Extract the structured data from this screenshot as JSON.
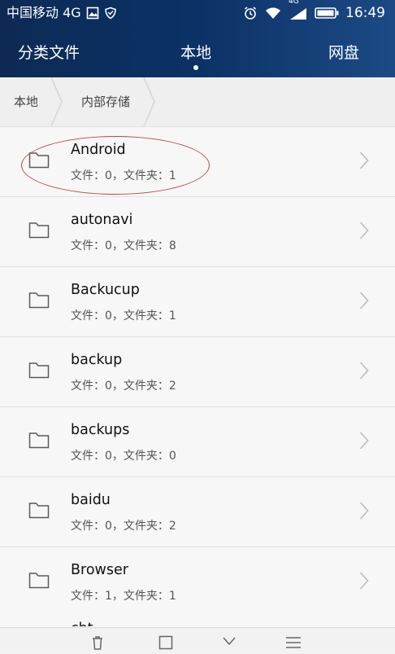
{
  "status_bar": {
    "carrier": "中国移动 4G",
    "network_label": "4G",
    "time": "16:49"
  },
  "tabs": [
    {
      "label": "分类文件"
    },
    {
      "label": "本地"
    },
    {
      "label": "网盘"
    }
  ],
  "breadcrumb": [
    {
      "label": "本地"
    },
    {
      "label": "内部存储"
    }
  ],
  "items": [
    {
      "name": "Android",
      "meta": "文件：0，文件夹：1"
    },
    {
      "name": "autonavi",
      "meta": "文件：0，文件夹：8"
    },
    {
      "name": "Backucup",
      "meta": "文件：0，文件夹：1"
    },
    {
      "name": "backup",
      "meta": "文件：0，文件夹：2"
    },
    {
      "name": "backups",
      "meta": "文件：0，文件夹：0"
    },
    {
      "name": "baidu",
      "meta": "文件：0，文件夹：2"
    },
    {
      "name": "Browser",
      "meta": "文件：1，文件夹：1"
    }
  ],
  "peek_item": {
    "name": "cbt"
  },
  "icons": {
    "folder": "folder-icon",
    "chevron": "chevron-right-icon",
    "alarm": "alarm-icon",
    "wifi": "wifi-icon",
    "signal": "signal-icon",
    "battery": "battery-icon",
    "image": "image-icon",
    "shield": "shield-icon"
  },
  "colors": {
    "header_bg": "#0b3266",
    "list_bg": "#f7f7f7",
    "annotation": "#b94a4a"
  }
}
